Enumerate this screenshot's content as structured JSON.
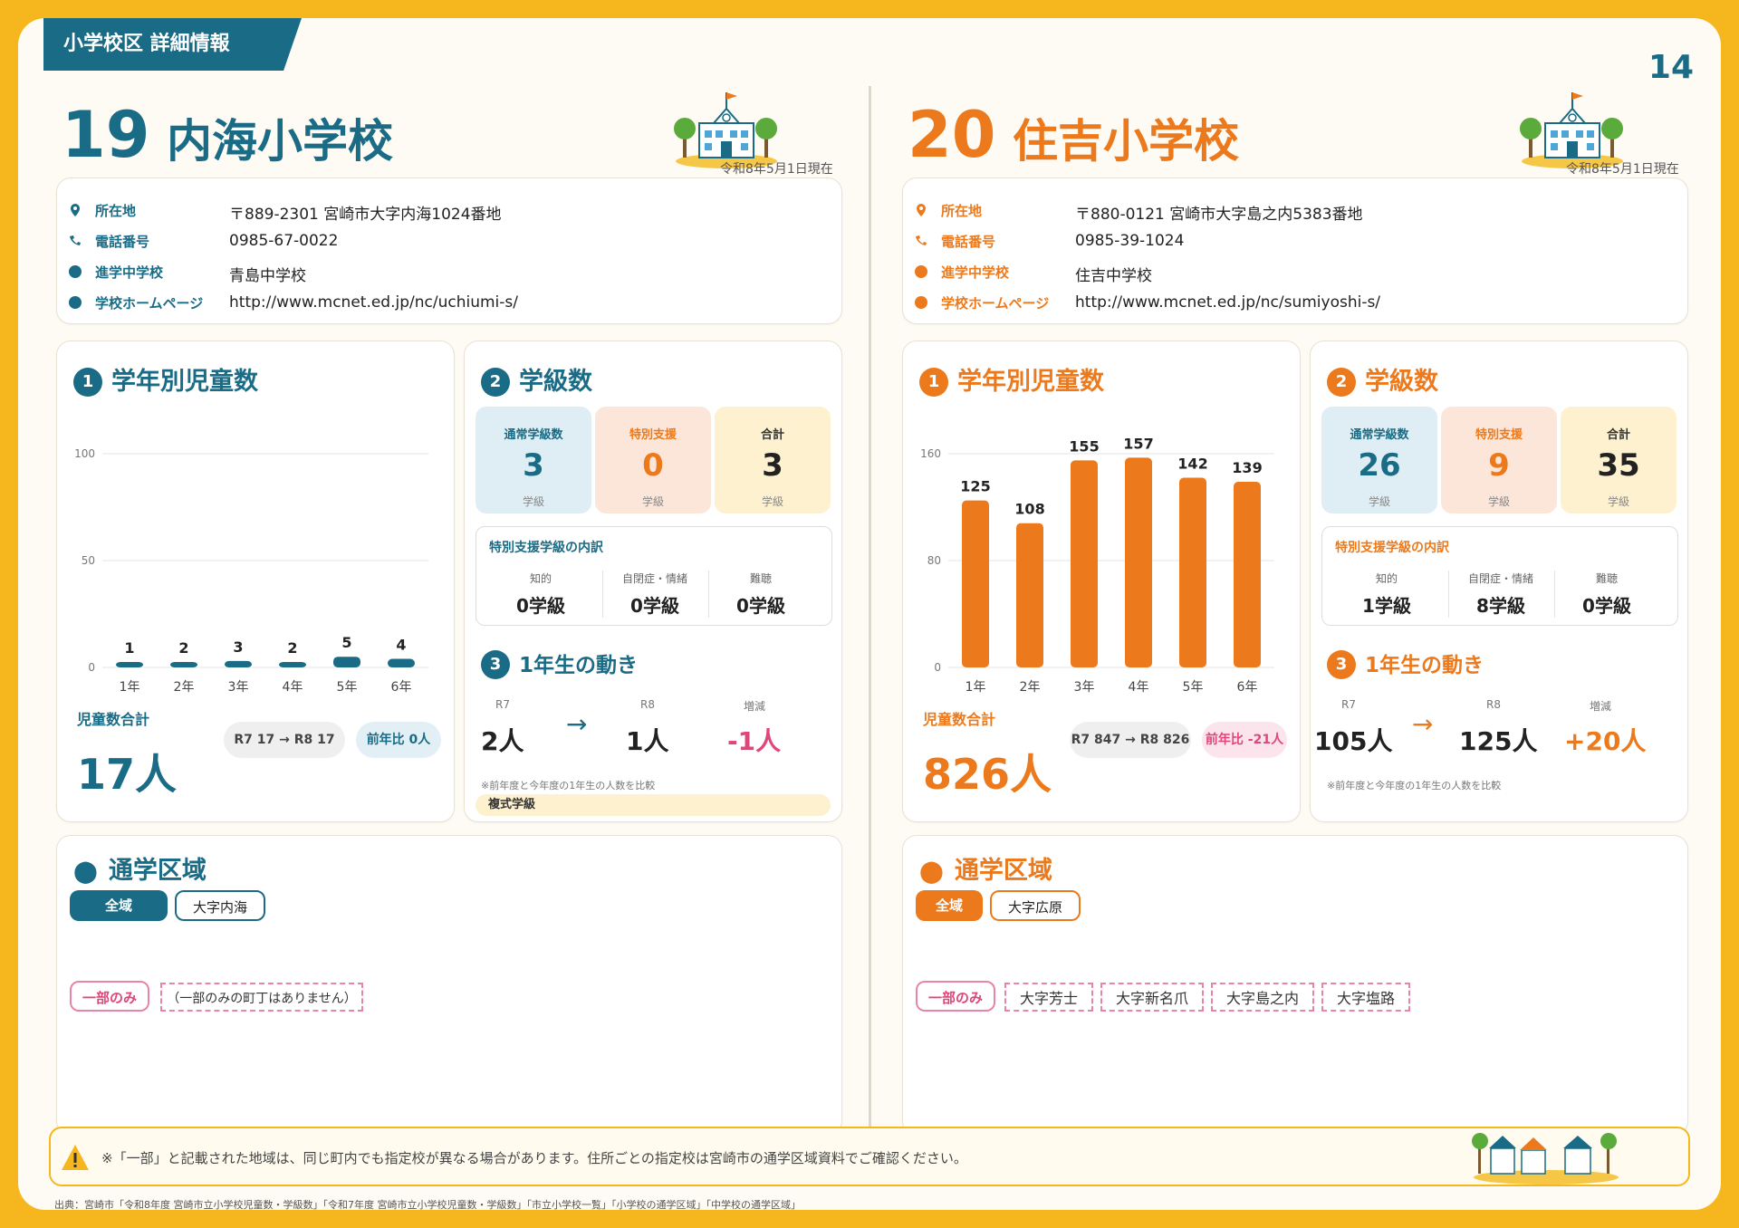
{
  "header": {
    "banner": "小学校区 詳細情報",
    "page_number": "14"
  },
  "colors": {
    "teal": "#1A6B85",
    "orange": "#EC7A1C",
    "pink": "#E0457B"
  },
  "schools": [
    {
      "number": "19",
      "name": "内海小学校",
      "as_of": "令和8年5月1日現在",
      "info": {
        "address_label": "所在地",
        "address": "〒889-2301 宮崎市大字内海1024番地",
        "phone_label": "電話番号",
        "phone": "0985-67-0022",
        "junior_label": "進学中学校",
        "junior": "青島中学校",
        "homepage_label": "学校ホームページ",
        "homepage": "http://www.mcnet.ed.jp/nc/uchiumi-s/"
      },
      "students": {
        "section_number": "1",
        "title": "学年別児童数",
        "total_label": "児童数合計",
        "total": "17人",
        "comparison": "R7 17 → R8 17",
        "yoy": "前年比 0人"
      },
      "classes": {
        "section_number": "2",
        "title": "学級数",
        "regular_label": "通常学級数",
        "regular": "3",
        "regular_unit": "学級",
        "special_label": "特別支援",
        "special": "0",
        "special_unit": "学級",
        "total_label": "合計",
        "total": "3",
        "total_unit": "学級",
        "breakdown_title": "特別支援学級の内訳",
        "breakdown": [
          {
            "label": "知的",
            "value": "0学級"
          },
          {
            "label": "自閉症・情緒",
            "value": "0学級"
          },
          {
            "label": "難聴",
            "value": "0学級"
          }
        ]
      },
      "first_grade": {
        "section_number": "3",
        "title": "1年生の動き",
        "r7_label": "R7",
        "r7": "2人",
        "r8_label": "R8",
        "r8": "1人",
        "change_label": "増減",
        "change": "-1人",
        "note": "※前年度と今年度の1年生の人数を比較",
        "badge": "複式学級"
      },
      "district": {
        "title": "通学区域",
        "all_label": "全域",
        "all_areas": [
          "大字内海"
        ],
        "partial_label": "一部のみ",
        "partial_areas": [
          "（一部のみの町丁はありません）"
        ]
      }
    },
    {
      "number": "20",
      "name": "住吉小学校",
      "as_of": "令和8年5月1日現在",
      "info": {
        "address_label": "所在地",
        "address": "〒880-0121 宮崎市大字島之内5383番地",
        "phone_label": "電話番号",
        "phone": "0985-39-1024",
        "junior_label": "進学中学校",
        "junior": "住吉中学校",
        "homepage_label": "学校ホームページ",
        "homepage": "http://www.mcnet.ed.jp/nc/sumiyoshi-s/"
      },
      "students": {
        "section_number": "1",
        "title": "学年別児童数",
        "total_label": "児童数合計",
        "total": "826人",
        "comparison": "R7 847 → R8 826",
        "yoy": "前年比 -21人"
      },
      "classes": {
        "section_number": "2",
        "title": "学級数",
        "regular_label": "通常学級数",
        "regular": "26",
        "regular_unit": "学級",
        "special_label": "特別支援",
        "special": "9",
        "special_unit": "学級",
        "total_label": "合計",
        "total": "35",
        "total_unit": "学級",
        "breakdown_title": "特別支援学級の内訳",
        "breakdown": [
          {
            "label": "知的",
            "value": "1学級"
          },
          {
            "label": "自閉症・情緒",
            "value": "8学級"
          },
          {
            "label": "難聴",
            "value": "0学級"
          }
        ]
      },
      "first_grade": {
        "section_number": "3",
        "title": "1年生の動き",
        "r7_label": "R7",
        "r7": "105人",
        "r8_label": "R8",
        "r8": "125人",
        "change_label": "増減",
        "change": "+20人",
        "note": "※前年度と今年度の1年生の人数を比較"
      },
      "district": {
        "title": "通学区域",
        "all_label": "全域",
        "all_areas": [
          "大字広原"
        ],
        "partial_label": "一部のみ",
        "partial_areas": [
          "大字芳士",
          "大字新名爪",
          "大字島之内",
          "大字塩路"
        ]
      }
    }
  ],
  "chart_data": [
    {
      "type": "bar",
      "categories": [
        "1年",
        "2年",
        "3年",
        "4年",
        "5年",
        "6年"
      ],
      "values": [
        1,
        2,
        3,
        2,
        5,
        4
      ],
      "ylim": [
        0,
        100
      ],
      "yticks": [
        "0",
        "50",
        "100"
      ],
      "color": "#1A6B85"
    },
    {
      "type": "bar",
      "categories": [
        "1年",
        "2年",
        "3年",
        "4年",
        "5年",
        "6年"
      ],
      "values": [
        125,
        108,
        155,
        157,
        142,
        139
      ],
      "ylim": [
        0,
        160
      ],
      "yticks": [
        "0",
        "80",
        "160"
      ],
      "color": "#EC7A1C"
    }
  ],
  "footer": {
    "note": "※「一部」と記載された地域は、同じ町内でも指定校が異なる場合があります。住所ごとの指定校は宮崎市の通学区域資料でご確認ください。",
    "source": "出典：宮崎市「令和8年度 宮崎市立小学校児童数・学級数」「令和7年度 宮崎市立小学校児童数・学級数」「市立小学校一覧」「小学校の通学区域」「中学校の通学区域」"
  }
}
